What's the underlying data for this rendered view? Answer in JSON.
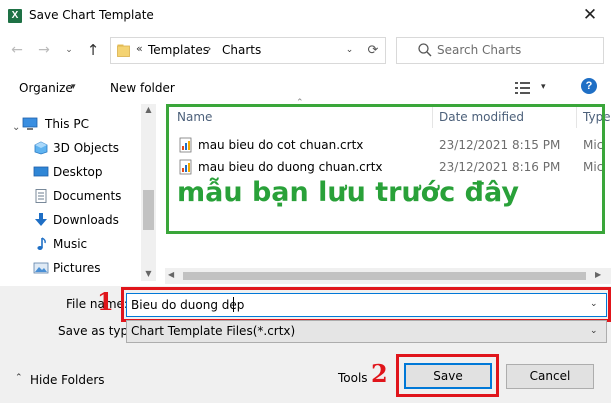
{
  "window": {
    "title": "Save Chart Template",
    "app_icon_letter": "X",
    "close_glyph": "✕"
  },
  "nav": {
    "back_glyph": "←",
    "forward_glyph": "→",
    "recent_glyph": "⌄",
    "up_glyph": "↑",
    "address": {
      "chevron": "«",
      "parts": [
        "Templates",
        "Charts"
      ],
      "separator": "›",
      "dropdown_glyph": "⌄",
      "refresh_glyph": "⟳"
    },
    "search": {
      "placeholder": "Search Charts"
    }
  },
  "toolbar": {
    "organize": "Organize",
    "dropdown_glyph": "▾",
    "new_folder": "New folder",
    "help_glyph": "?"
  },
  "sidebar": {
    "expand_glyph": "⌄",
    "items": [
      {
        "label": "This PC",
        "icon": "computer-icon"
      },
      {
        "label": "3D Objects",
        "icon": "cube-icon"
      },
      {
        "label": "Desktop",
        "icon": "desktop-icon"
      },
      {
        "label": "Documents",
        "icon": "documents-icon"
      },
      {
        "label": "Downloads",
        "icon": "downloads-icon"
      },
      {
        "label": "Music",
        "icon": "music-icon"
      },
      {
        "label": "Pictures",
        "icon": "pictures-icon"
      }
    ]
  },
  "file_list": {
    "columns": [
      "Name",
      "Date modified",
      "Type"
    ],
    "rows": [
      {
        "name": "mau bieu do cot chuan.crtx",
        "date": "23/12/2021 8:15 PM",
        "type": "Mic"
      },
      {
        "name": "mau bieu do duong chuan.crtx",
        "date": "23/12/2021 8:16 PM",
        "type": "Mic"
      }
    ],
    "annotation": "mẫu bạn lưu trước đây"
  },
  "form": {
    "file_name_label": "File name:",
    "file_name_value": "Bieu do duong dep",
    "save_as_type_label": "Save as type:",
    "save_as_type_value": "Chart Template Files(*.crtx)"
  },
  "footer": {
    "hide_folders": "Hide Folders",
    "hide_glyph": "⌃",
    "tools": "Tools",
    "save": "Save",
    "cancel": "Cancel"
  },
  "annotations": {
    "marker_1": "1",
    "marker_2": "2"
  },
  "colors": {
    "annotation_green": "#29a139",
    "annotation_red": "#e0151b",
    "accent_blue": "#0078d7",
    "excel_green": "#1e7145"
  }
}
